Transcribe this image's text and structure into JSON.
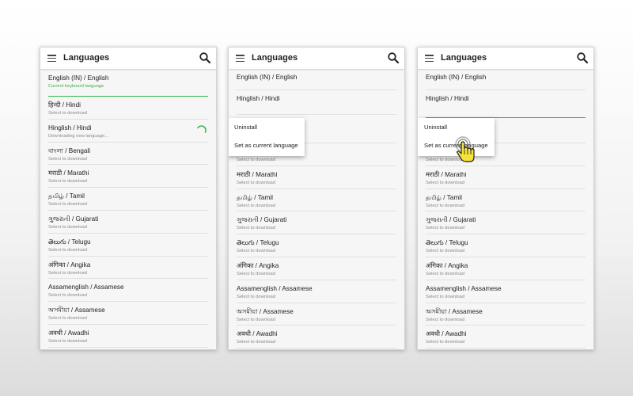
{
  "title": "Languages",
  "languages": [
    {
      "name": "English (IN) / English",
      "status": "Current keyboard language"
    },
    {
      "name": "हिन्दी / Hindi",
      "status": "Select to download"
    },
    {
      "name": "Hinglish / Hindi",
      "status": "Select to download"
    },
    {
      "name": "বাংলা / Bengali",
      "status": "Select to download"
    },
    {
      "name": "मराठी / Marathi",
      "status": "Select to download"
    },
    {
      "name": "தமிழ் / Tamil",
      "status": "Select to download"
    },
    {
      "name": "ગુજરાતી / Gujarati",
      "status": "Select to download"
    },
    {
      "name": "తెలుగు / Telugu",
      "status": "Select to download"
    },
    {
      "name": "अंगिका / Angika",
      "status": "Select to download"
    },
    {
      "name": "Assamenglish / Assamese",
      "status": "Select to download"
    },
    {
      "name": "অসমীয়া / Assamese",
      "status": "Select to download"
    },
    {
      "name": "अवधी / Awadhi",
      "status": "Select to download"
    }
  ],
  "downloading_status": "Downloading new language...",
  "menu": {
    "uninstall": "Uninstall",
    "set_current": "Set as current language"
  },
  "accent_color": "#35b44a"
}
